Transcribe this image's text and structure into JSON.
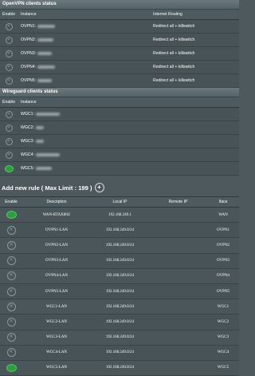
{
  "openvpn": {
    "title": "OpenVPN clients status",
    "headers": {
      "enable": "Enable",
      "instance": "Instance",
      "routing": "Internet Routing"
    },
    "rows": [
      {
        "instance": "OVPN1: ",
        "routing": "Redirect all + killswitch",
        "enabled": false
      },
      {
        "instance": "OVPN2: ",
        "routing": "Redirect all + killswitch",
        "enabled": false
      },
      {
        "instance": "OVPN3: ",
        "routing": "Redirect all + killswitch",
        "enabled": false
      },
      {
        "instance": "OVPN4: ",
        "routing": "Redirect all + killswitch",
        "enabled": false
      },
      {
        "instance": "OVPN5: ",
        "routing": "Redirect all + killswitch",
        "enabled": false
      }
    ]
  },
  "wireguard": {
    "title": "Wireguard clients status",
    "headers": {
      "enable": "Enable",
      "instance": "Instance"
    },
    "rows": [
      {
        "instance": "WGC1: ",
        "enabled": false
      },
      {
        "instance": "WGC2: ",
        "enabled": false
      },
      {
        "instance": "WGC3: ",
        "enabled": false
      },
      {
        "instance": "WGC4: ",
        "enabled": false
      },
      {
        "instance": "WGC5: ",
        "enabled": true
      }
    ]
  },
  "rules": {
    "add_label": "Add new rule ( Max Limit : 199 )",
    "add_icon": "plus-circle-icon",
    "headers": {
      "enable": "Enable",
      "description": "Description",
      "local_ip": "Local IP",
      "remote_ip": "Remote IP",
      "iface": "Iface"
    },
    "rows": [
      {
        "enabled": true,
        "description": "WAN-RTAX86U",
        "local_ip": "192.168.249.1",
        "remote_ip": "",
        "iface": "WAN"
      },
      {
        "enabled": false,
        "description": "OVPN1-LAN",
        "local_ip": "192.168.249.0/24",
        "remote_ip": "",
        "iface": "OVPN1"
      },
      {
        "enabled": false,
        "description": "OVPN2-LAN",
        "local_ip": "192.168.249.0/24",
        "remote_ip": "",
        "iface": "OVPN2"
      },
      {
        "enabled": false,
        "description": "OVPN3-LAN",
        "local_ip": "192.168.249.0/24",
        "remote_ip": "",
        "iface": "OVPN3"
      },
      {
        "enabled": false,
        "description": "OVPN4-LAN",
        "local_ip": "192.168.249.0/24",
        "remote_ip": "",
        "iface": "OVPN4"
      },
      {
        "enabled": false,
        "description": "OVPN5-LAN",
        "local_ip": "192.168.249.0/24",
        "remote_ip": "",
        "iface": "OVPN5"
      },
      {
        "enabled": false,
        "description": "WGC1-LAN",
        "local_ip": "192.168.249.0/24",
        "remote_ip": "",
        "iface": "WGC1"
      },
      {
        "enabled": false,
        "description": "WGC2-LAN",
        "local_ip": "192.168.249.0/24",
        "remote_ip": "",
        "iface": "WGC2"
      },
      {
        "enabled": false,
        "description": "WGC3-LAN",
        "local_ip": "192.168.249.0/24",
        "remote_ip": "",
        "iface": "WGC3"
      },
      {
        "enabled": false,
        "description": "WGC4-LAN",
        "local_ip": "192.168.249.0/24",
        "remote_ip": "",
        "iface": "WGC4"
      },
      {
        "enabled": true,
        "description": "WGC5-LAN",
        "local_ip": "192.168.249.0/24",
        "remote_ip": "",
        "iface": "WGC5"
      }
    ]
  },
  "colors": {
    "background": "#4d595d",
    "enabled": "#2f9e3f"
  }
}
